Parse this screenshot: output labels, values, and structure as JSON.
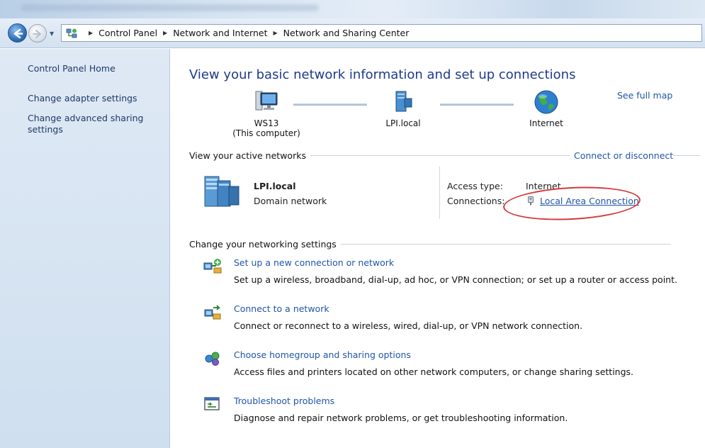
{
  "address_bar": {
    "breadcrumbs": [
      "Control Panel",
      "Network and Internet",
      "Network and Sharing Center"
    ]
  },
  "left_pane": {
    "home": "Control Panel Home",
    "links": [
      "Change adapter settings",
      "Change advanced sharing settings"
    ]
  },
  "main": {
    "headline": "View your basic network information and set up connections",
    "see_full_map": "See full map",
    "map": {
      "computer_name": "WS13",
      "computer_note": "(This computer)",
      "network_name": "LPI.local",
      "internet_label": "Internet"
    },
    "active_networks": {
      "title": "View your active networks",
      "connect_link": "Connect or disconnect",
      "network_name": "LPI.local",
      "network_type": "Domain network",
      "access_type_label": "Access type:",
      "access_type_value": "Internet",
      "connections_label": "Connections:",
      "connections_value": "Local Area Connection"
    },
    "settings": {
      "title": "Change your networking settings",
      "tasks": [
        {
          "link": "Set up a new connection or network",
          "desc": "Set up a wireless, broadband, dial-up, ad hoc, or VPN connection; or set up a router or access point."
        },
        {
          "link": "Connect to a network",
          "desc": "Connect or reconnect to a wireless, wired, dial-up, or VPN network connection."
        },
        {
          "link": "Choose homegroup and sharing options",
          "desc": "Access files and printers located on other network computers, or change sharing settings."
        },
        {
          "link": "Troubleshoot problems",
          "desc": "Diagnose and repair network problems, or get troubleshooting information."
        }
      ]
    }
  },
  "colors": {
    "link": "#1f55a8",
    "headline": "#1e3a8a",
    "highlight_ellipse": "#d33a3a",
    "left_pane_bg": "#dfe9f5"
  },
  "icons": [
    "back-arrow-icon",
    "forward-arrow-icon",
    "network-center-icon",
    "computer-icon",
    "server-icon",
    "globe-icon",
    "domain-network-icon",
    "ethernet-plug-icon",
    "new-connection-icon",
    "connect-network-icon",
    "homegroup-icon",
    "troubleshoot-icon"
  ]
}
